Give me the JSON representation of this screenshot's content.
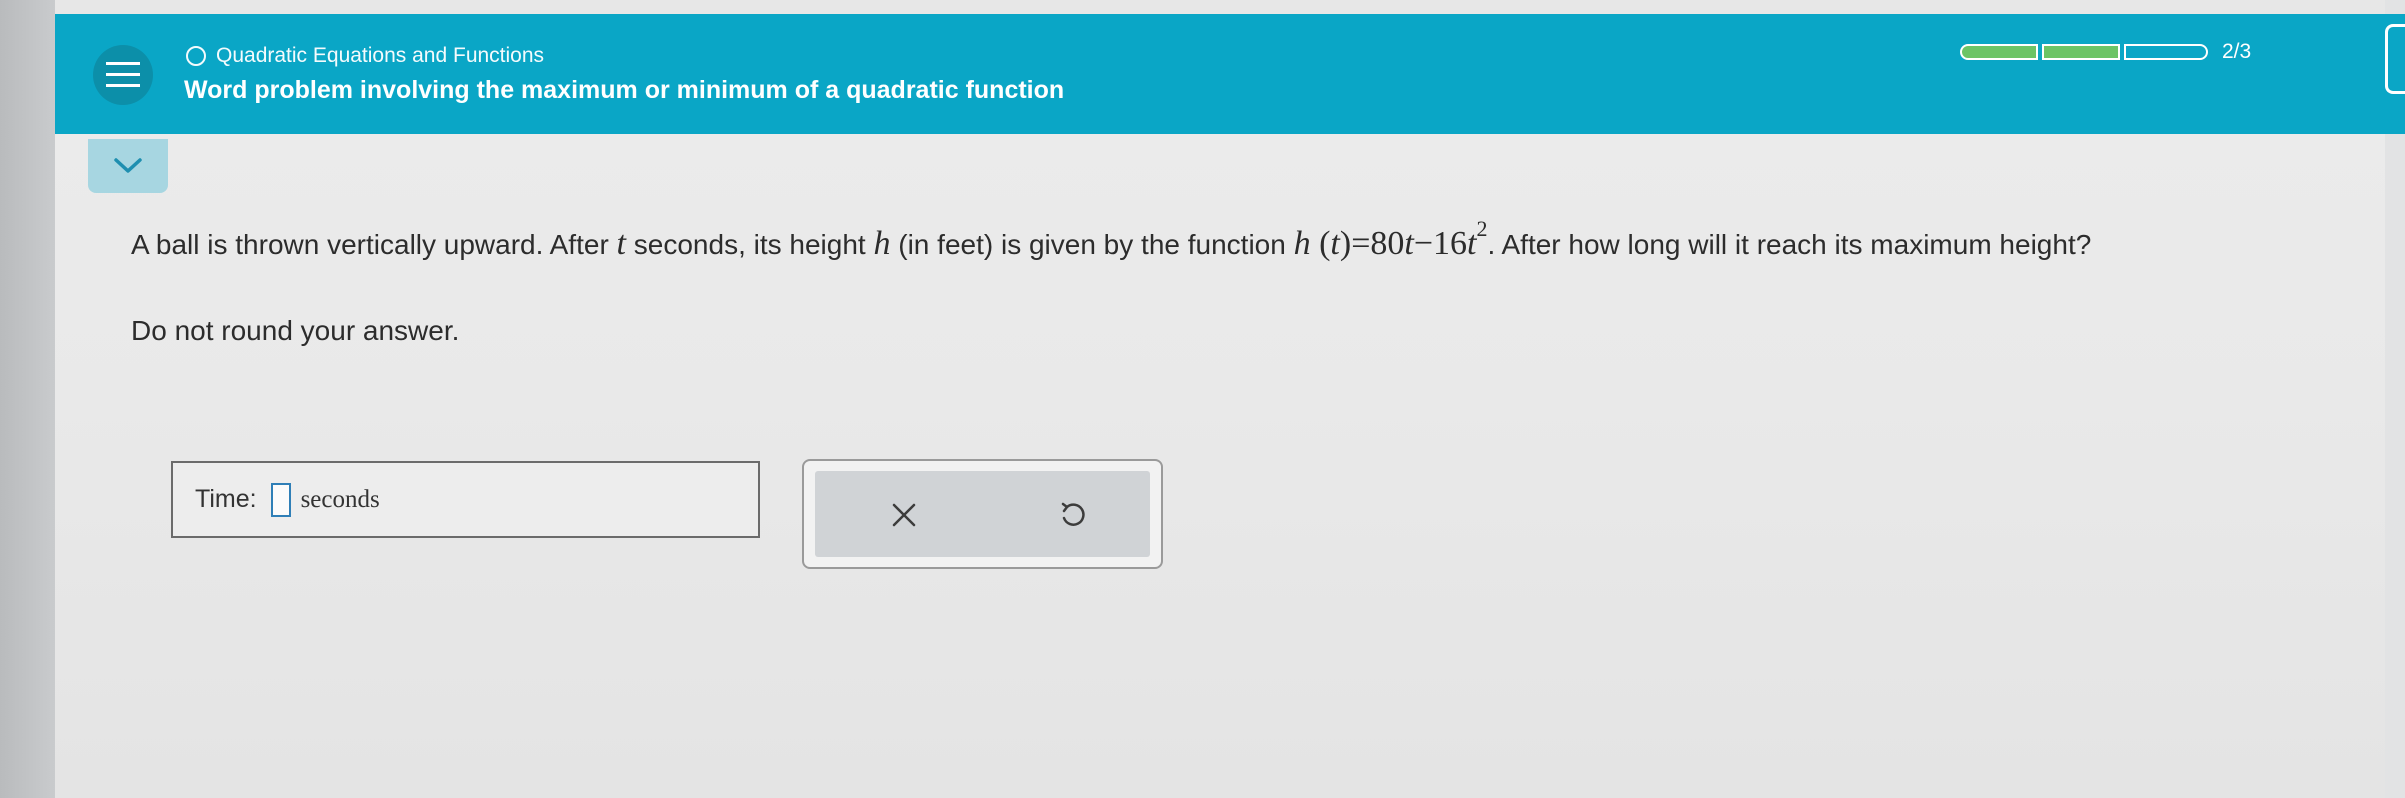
{
  "header": {
    "breadcrumb": "Quadratic Equations and Functions",
    "title": "Word problem involving the maximum or minimum of a quadratic function",
    "progress_text": "2/3",
    "progress": {
      "completed": 2,
      "total": 3
    },
    "accent_color": "#0aa6c6",
    "progress_fill_color": "#6cc466"
  },
  "question": {
    "text_1": "A ball is thrown vertically upward. After ",
    "var_t": "t",
    "text_2": " seconds, its height ",
    "var_h": "h",
    "text_3": " (in feet) is given by the function ",
    "fn_h": "h",
    "fn_paren_open": " (",
    "fn_t": "t",
    "fn_paren_close": ")",
    "fn_eq": "=80",
    "fn_t2": "t",
    "fn_minus": "−",
    "fn_16": "16",
    "fn_t3": "t",
    "fn_exp": "2",
    "text_4": ". After how long will it reach its maximum height?"
  },
  "instruction": "Do not round your answer.",
  "answer": {
    "label": "Time:",
    "value": "",
    "unit": "seconds"
  },
  "actions": {
    "clear_icon": "x-icon",
    "undo_icon": "undo-icon"
  }
}
